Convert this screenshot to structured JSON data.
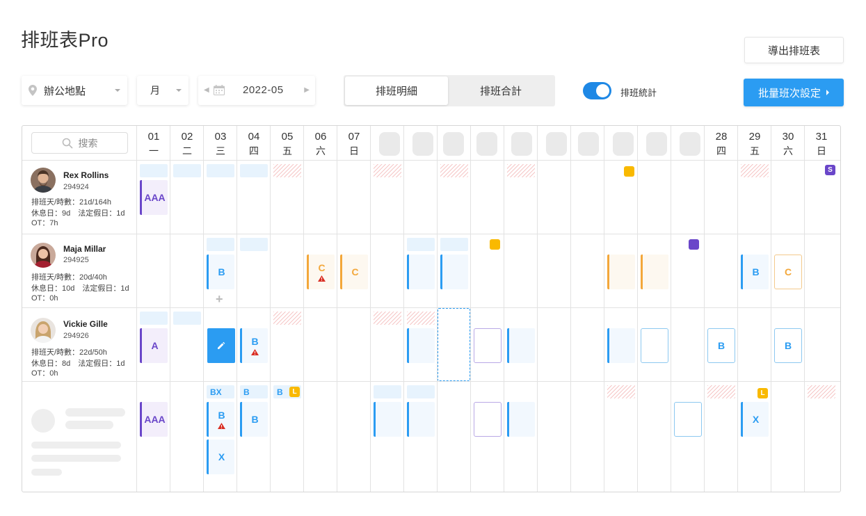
{
  "title": "排班表Pro",
  "export_label": "導出排班表",
  "filters": {
    "location": "辦公地點",
    "period": "月",
    "date": "2022-05"
  },
  "tabs": [
    {
      "label": "排班明細"
    },
    {
      "label": "排班合計"
    }
  ],
  "toggle_label": "排班統計",
  "bulk_label": "批量班次設定",
  "search_placeholder": "搜索",
  "days": [
    {
      "num": "01",
      "wd": "一"
    },
    {
      "num": "02",
      "wd": "二"
    },
    {
      "num": "03",
      "wd": "三"
    },
    {
      "num": "04",
      "wd": "四"
    },
    {
      "num": "05",
      "wd": "五"
    },
    {
      "num": "06",
      "wd": "六"
    },
    {
      "num": "07",
      "wd": "日"
    },
    {
      "num": "28",
      "wd": "四"
    },
    {
      "num": "29",
      "wd": "五"
    },
    {
      "num": "30",
      "wd": "六"
    },
    {
      "num": "31",
      "wd": "日"
    }
  ],
  "employees": [
    {
      "name": "Rex Rollins",
      "id": "294924",
      "line1": "排班天/時數：21d/164h",
      "line2": "休息日：9d　法定假日：1d",
      "line3": "OT：7h"
    },
    {
      "name": "Maja Millar",
      "id": "294925",
      "line1": "排班天/時數：20d/40h",
      "line2": "休息日：10d　法定假日：1d",
      "line3": "OT：0h"
    },
    {
      "name": "Vickie Gille",
      "id": "294926",
      "line1": "排班天/時數：22d/50h",
      "line2": "休息日：8d　法定假日：1d",
      "line3": "OT：0h"
    }
  ],
  "shifts": {
    "aaa": "AAA",
    "a": "A",
    "b": "B",
    "c": "C",
    "x": "X",
    "bx": "BX",
    "badge_s": "S",
    "badge_l": "L"
  },
  "colors": {
    "accent": "#2b9cf2",
    "purple": "#6a46c9",
    "orange": "#f3a73a",
    "yellow": "#f9b900"
  }
}
